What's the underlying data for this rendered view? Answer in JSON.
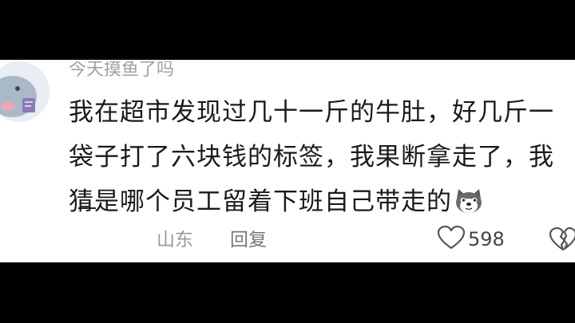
{
  "comment": {
    "username": "今天摸鱼了吗",
    "lines": [
      "我在超市发现过几十一斤的牛肚，好几斤一",
      "袋子打了六块钱的标签，我果断拿走了，我",
      "猜是哪个员工留着下班自己带走的"
    ],
    "emoji": "doge-emoji",
    "location": "山东",
    "reply_label": "回复",
    "like_count": "598",
    "icons": {
      "like": "heart-outline-icon",
      "dislike": "broken-heart-icon"
    }
  }
}
